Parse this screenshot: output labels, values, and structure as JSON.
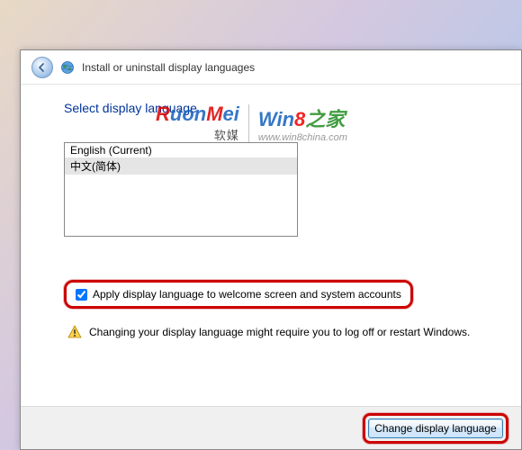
{
  "title": "Install or uninstall display languages",
  "heading": "Select display language",
  "languages": [
    {
      "label": "English (Current)"
    },
    {
      "label": "中文(简体)"
    }
  ],
  "checkbox": {
    "label": "Apply display language to welcome screen and system accounts",
    "checked": true
  },
  "warning": "Changing your display language might require you to log off or restart Windows.",
  "button": "Change display language",
  "watermark": {
    "ruonmei": "RuonMei",
    "ruonmei_cn": "软媒",
    "win8": "Win8之家",
    "url": "www.win8china.com"
  }
}
